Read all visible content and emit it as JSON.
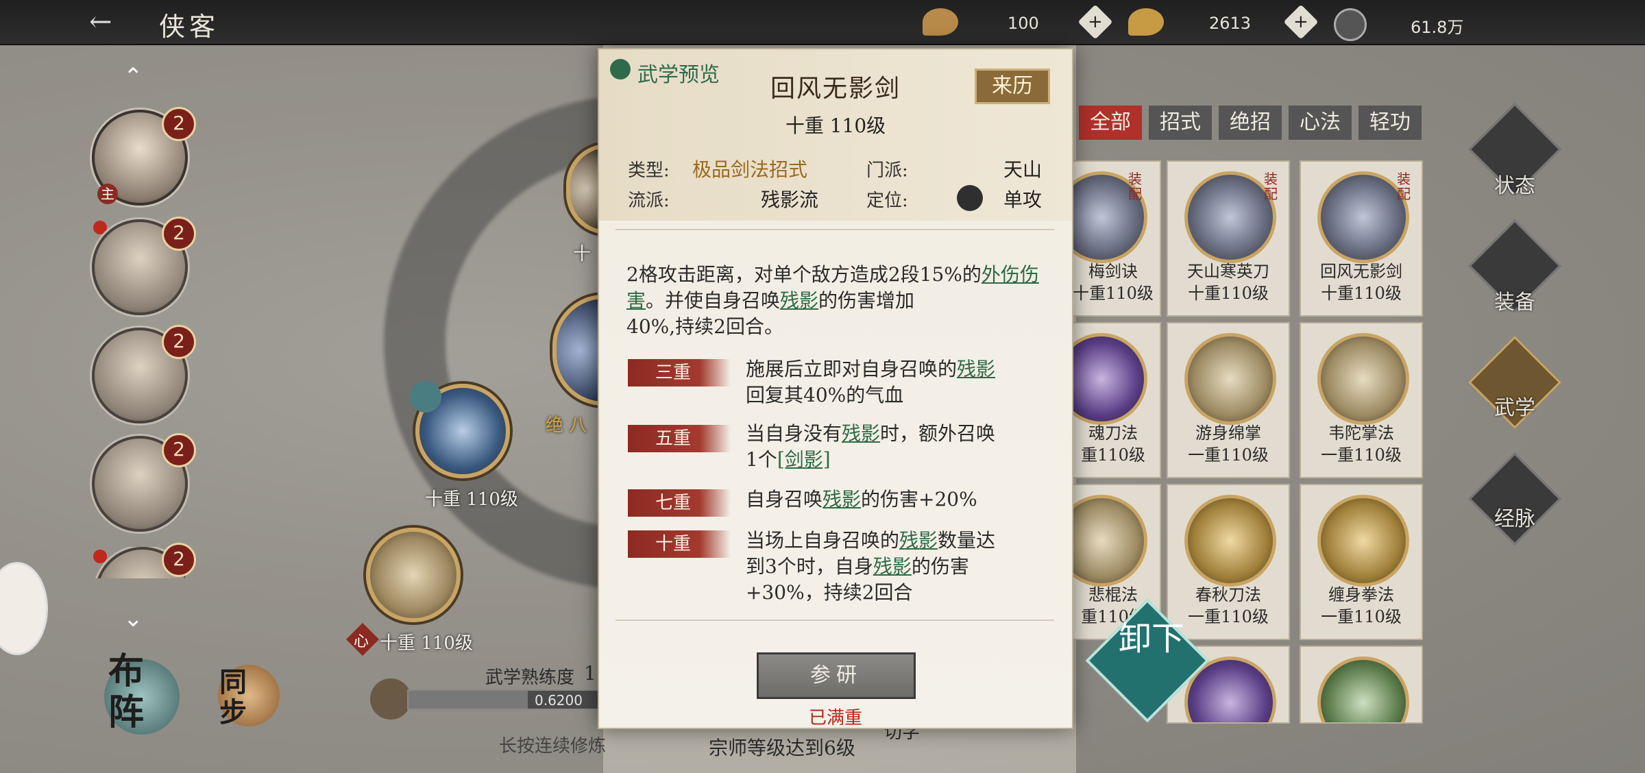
{
  "topbar": {
    "back_label": "侠客",
    "resources": [
      {
        "icon": "leaf-icon",
        "value": "100"
      },
      {
        "icon": "ingot-icon",
        "value": "2613"
      },
      {
        "icon": "coin-icon",
        "value": "61.8万"
      }
    ],
    "plus_glyph": "+"
  },
  "roster": {
    "badges": [
      "2",
      "2",
      "2",
      "2",
      "2"
    ],
    "main_tag": "主"
  },
  "skill_tree": {
    "node_labels": [
      "十重 110级",
      "十重 110级"
    ],
    "partial_labels": [
      "十",
      "绝 八"
    ],
    "xin_tag": "心",
    "proficiency_label": "武学熟练度",
    "proficiency_value": "1",
    "progress_text": "0.6200",
    "progress_fraction": 0.62,
    "hold_hint": "长按连续修炼",
    "master_hint": "宗师等级达到6级",
    "partial_bottom": "切字"
  },
  "left_buttons": {
    "formation": "布阵",
    "sync": "同步"
  },
  "popup": {
    "preview_tag": "武学预览",
    "name": "回风无影剑",
    "origin_button": "来历",
    "level": "十重 110级",
    "type_key": "类型:",
    "type_val": "极品剑法招式",
    "sect_key": "门派:",
    "sect_val": "天山",
    "school_key": "流派:",
    "school_val": "残影流",
    "role_key": "定位:",
    "role_val": "单攻",
    "desc_a": "2格攻击距离，对单个敌方造成2段15%的",
    "desc_ul1": "外伤伤害",
    "desc_b": "。并使自身召唤",
    "desc_ul2": "残影",
    "desc_c": "的伤害增加",
    "desc_d": "40%,持续2回合。",
    "tiers": [
      {
        "tag": "三重",
        "t1": "施展后立即对自身召唤的",
        "u": "残影",
        "t2": "回复其40%的气血"
      },
      {
        "tag": "五重",
        "t1": "当自身没有",
        "u": "残影",
        "t2": "时，额外召唤",
        "t3": "1个",
        "u2": "[剑影]"
      },
      {
        "tag": "七重",
        "t1": "自身召唤",
        "u": "残影",
        "t2": "的伤害+20%"
      },
      {
        "tag": "十重",
        "t1": "当场上自身召唤的",
        "u": "残影",
        "t2": "数量达",
        "t3": "到3个时，自身",
        "u2": "残影",
        "t4": "的伤害",
        "t5": "+30%，持续2回合"
      }
    ],
    "study_button": "参研",
    "maxed_text": "已满重"
  },
  "tabs": [
    "全部",
    "招式",
    "绝招",
    "心法",
    "轻功"
  ],
  "cards": [
    {
      "name": "梅剑诀",
      "level": "十重110级",
      "equipped": "装配"
    },
    {
      "name": "天山寒英刀",
      "level": "十重110级",
      "equipped": "装配"
    },
    {
      "name": "回风无影剑",
      "level": "十重110级",
      "equipped": "装配"
    },
    {
      "name": "魂刀法",
      "level": "重110级"
    },
    {
      "name": "游身绵掌",
      "level": "一重110级"
    },
    {
      "name": "韦陀掌法",
      "level": "一重110级"
    },
    {
      "name": "悲棍法",
      "level": "重110级"
    },
    {
      "name": "春秋刀法",
      "level": "一重110级"
    },
    {
      "name": "缠身拳法",
      "level": "一重110级"
    }
  ],
  "side_menu": [
    "状态",
    "装备",
    "武学",
    "经脉"
  ],
  "unequip_button": "卸下"
}
